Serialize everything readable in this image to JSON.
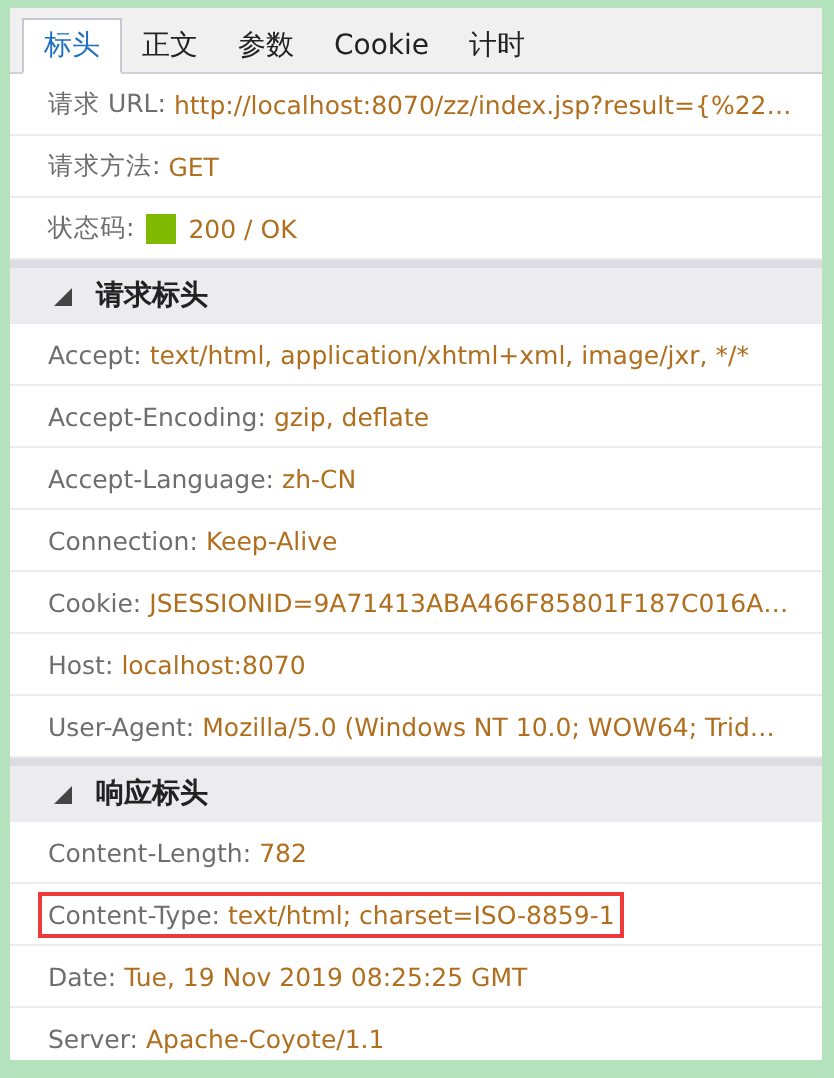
{
  "tabs": [
    {
      "label": "标头",
      "selected": true
    },
    {
      "label": "正文",
      "selected": false
    },
    {
      "label": "参数",
      "selected": false
    },
    {
      "label": "Cookie",
      "selected": false
    },
    {
      "label": "计时",
      "selected": false
    }
  ],
  "sections": [
    {
      "rows": [
        {
          "kind": "plain",
          "name": "请求 URL:",
          "value": "http://localhost:8070/zz/index.jsp?result={%22…",
          "highlighted": false
        },
        {
          "kind": "plain",
          "name": "请求方法:",
          "value": "GET",
          "highlighted": false
        },
        {
          "kind": "status",
          "name": "状态码:",
          "value": "200 / OK",
          "color": "#7fba00",
          "highlighted": false
        }
      ]
    },
    {
      "title": "请求标头",
      "expanded": true,
      "rows": [
        {
          "kind": "plain",
          "name": "Accept:",
          "value": "text/html, application/xhtml+xml, image/jxr, */*",
          "highlighted": false
        },
        {
          "kind": "plain",
          "name": "Accept-Encoding:",
          "value": "gzip, deflate",
          "highlighted": false
        },
        {
          "kind": "plain",
          "name": "Accept-Language:",
          "value": "zh-CN",
          "highlighted": false
        },
        {
          "kind": "plain",
          "name": "Connection:",
          "value": "Keep-Alive",
          "highlighted": false
        },
        {
          "kind": "plain",
          "name": "Cookie:",
          "value": "JSESSIONID=9A71413ABA466F85801F187C016A…",
          "highlighted": false
        },
        {
          "kind": "plain",
          "name": "Host:",
          "value": "localhost:8070",
          "highlighted": false
        },
        {
          "kind": "plain",
          "name": "User-Agent:",
          "value": "Mozilla/5.0 (Windows NT 10.0; WOW64; Trid…",
          "highlighted": false
        }
      ]
    },
    {
      "title": "响应标头",
      "expanded": true,
      "rows": [
        {
          "kind": "plain",
          "name": "Content-Length:",
          "value": "782",
          "highlighted": false
        },
        {
          "kind": "plain",
          "name": "Content-Type:",
          "value": "text/html; charset=ISO-8859-1",
          "highlighted": true
        },
        {
          "kind": "plain",
          "name": "Date:",
          "value": "Tue, 19 Nov 2019 08:25:25 GMT",
          "highlighted": false
        },
        {
          "kind": "plain",
          "name": "Server:",
          "value": "Apache-Coyote/1.1",
          "highlighted": false
        }
      ]
    }
  ]
}
